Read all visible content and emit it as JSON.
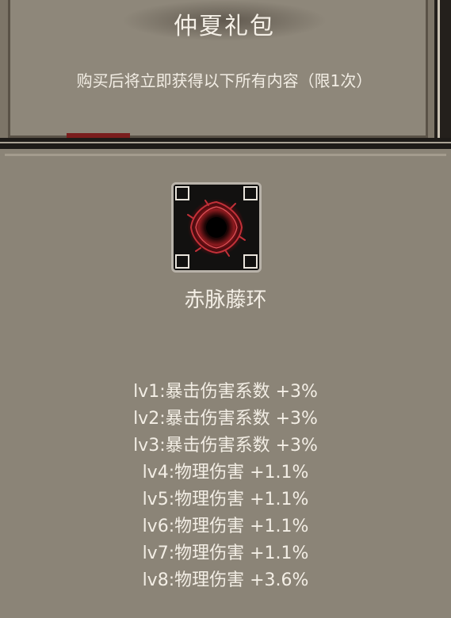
{
  "header": {
    "title": "仲夏礼包",
    "subtitle": "购买后将立即获得以下所有内容（限1次）"
  },
  "reward": {
    "icon": "thorn-ring-icon",
    "name": "赤脉藤环"
  },
  "stats": [
    "lv1:暴击伤害系数 +3%",
    "lv2:暴击伤害系数 +3%",
    "lv3:暴击伤害系数 +3%",
    "lv4:物理伤害 +1.1%",
    "lv5:物理伤害 +1.1%",
    "lv6:物理伤害 +1.1%",
    "lv7:物理伤害 +1.1%",
    "lv8:物理伤害 +3.6%"
  ],
  "colors": {
    "panel": "#8b8477",
    "text": "#f3eee5",
    "accent_red": "#7a1d1d"
  }
}
